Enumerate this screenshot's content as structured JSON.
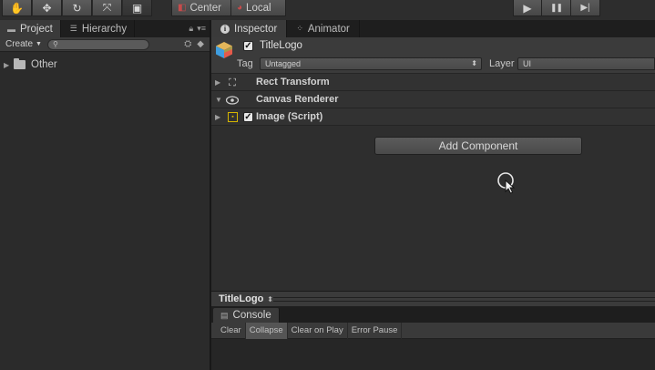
{
  "toolbar": {
    "tools": [
      {
        "icon": "hand-icon",
        "glyph": "✋"
      },
      {
        "icon": "move-icon",
        "glyph": "✥"
      },
      {
        "icon": "rotate-icon",
        "glyph": "↻"
      },
      {
        "icon": "scale-icon",
        "glyph": "⤧"
      },
      {
        "icon": "rect-tool-icon",
        "glyph": "▣"
      }
    ],
    "pivot_label": "Center",
    "space_label": "Local",
    "play_icons": {
      "play": "▶",
      "pause": "❚❚",
      "step": "▶|"
    }
  },
  "left_panel": {
    "tabs": [
      {
        "label": "Project",
        "icon": "folder-icon"
      },
      {
        "label": "Hierarchy",
        "icon": "list-icon"
      }
    ],
    "create_label": "Create",
    "search_placeholder": "",
    "tree": [
      {
        "label": "Other",
        "icon": "folder-icon"
      }
    ]
  },
  "inspector": {
    "tabs": [
      {
        "label": "Inspector",
        "icon": "info-icon"
      },
      {
        "label": "Animator",
        "icon": "animator-icon"
      }
    ],
    "object_name": "TitleLogo",
    "tag_label": "Tag",
    "tag_value": "Untagged",
    "layer_label": "Layer",
    "layer_value": "UI",
    "components": [
      {
        "label": "Rect Transform",
        "icon": "rect-transform-icon",
        "has_checkbox": false
      },
      {
        "label": "Canvas Renderer",
        "icon": "eye-icon",
        "has_checkbox": false
      },
      {
        "label": "Image (Script)",
        "icon": "image-script-icon",
        "has_checkbox": true
      }
    ],
    "add_component_label": "Add Component"
  },
  "preview": {
    "title": "TitleLogo"
  },
  "console": {
    "tab_label": "Console",
    "buttons": [
      {
        "label": "Clear",
        "active": false
      },
      {
        "label": "Collapse",
        "active": true
      },
      {
        "label": "Clear on Play",
        "active": false
      },
      {
        "label": "Error Pause",
        "active": false
      }
    ]
  },
  "colors": {
    "panel_bg": "#2b2b2b",
    "header_bg": "#3b3b3b",
    "image_icon": "#d6b600"
  }
}
